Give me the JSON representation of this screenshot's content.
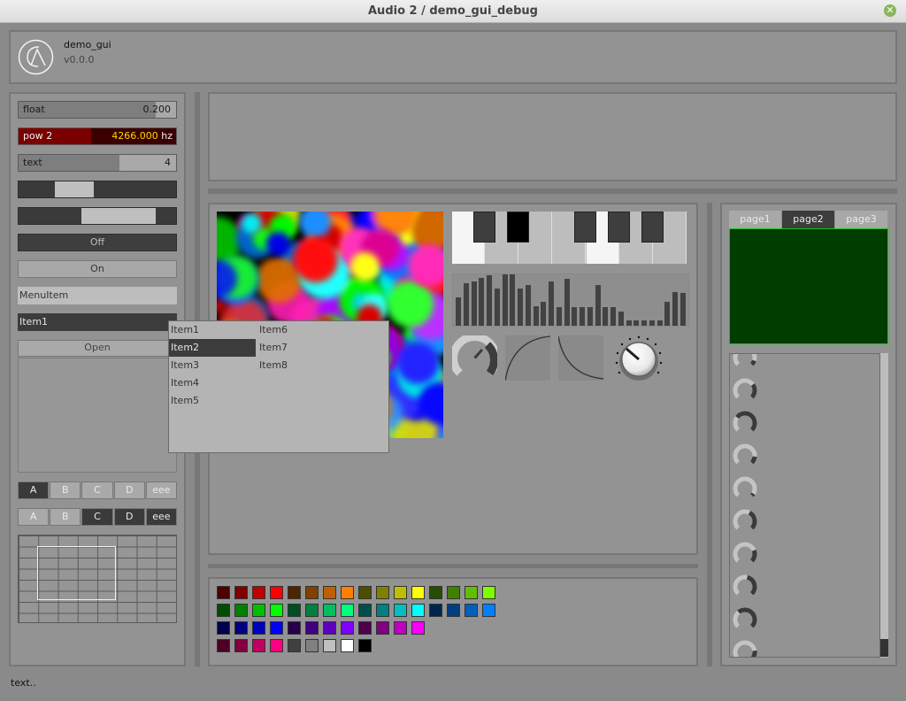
{
  "window": {
    "title": "Audio 2 / demo_gui_debug"
  },
  "header": {
    "app_name": "demo_gui",
    "version": "v0.0.0"
  },
  "controls": {
    "float": {
      "label": "float",
      "value": "0.200",
      "level": 0.87
    },
    "pow2": {
      "label": "pow 2",
      "value": "4266.000",
      "unit": "hz",
      "level": 0.46
    },
    "text": {
      "label": "text",
      "value": "4",
      "level": 0.64
    },
    "range1": {
      "low": 0.23,
      "high": 0.48
    },
    "range2": {
      "low": 0.4,
      "high": 0.87
    },
    "toggle_off": "Off",
    "toggle_on": "On",
    "menuitem": "MenuItem",
    "dropdown_selected": "Item1",
    "open_button": "Open",
    "segments_1": {
      "labels": [
        "A",
        "B",
        "C",
        "D",
        "eee"
      ],
      "active": [
        0
      ]
    },
    "segments_2": {
      "labels": [
        "A",
        "B",
        "C",
        "D",
        "eee"
      ],
      "active": [
        2,
        3,
        4
      ]
    }
  },
  "dropdown_menu": {
    "items": [
      "Item1",
      "Item2",
      "Item3",
      "Item4",
      "Item5",
      "Item6",
      "Item7",
      "Item8"
    ],
    "selected": "Item2"
  },
  "bar_levels": [
    0.55,
    0.83,
    0.87,
    0.93,
    0.98,
    0.72,
    1.0,
    1.0,
    0.72,
    0.8,
    0.38,
    0.47,
    0.87,
    0.37,
    0.92,
    0.37,
    0.37,
    0.37,
    0.8,
    0.37,
    0.37,
    0.28,
    0.11,
    0.11,
    0.11,
    0.11,
    0.11,
    0.47,
    0.65,
    0.63
  ],
  "keyboard": {
    "pressed_white_keys": [
      0,
      4
    ],
    "pressed_black_keys": [
      1
    ]
  },
  "tabs": {
    "items": [
      "page1",
      "page2",
      "page3"
    ],
    "active": "page2"
  },
  "colors": {
    "swatches": [
      [
        "#4d0000",
        "#800000",
        "#bf0000",
        "#ff0000",
        "#4d2600",
        "#804000",
        "#bf6000",
        "#ff8000",
        "#4d4d00",
        "#808000",
        "#bfbf00",
        "#ffff00",
        "#264d00",
        "#408000",
        "#60bf00",
        "#80ff00"
      ],
      [
        "#004d00",
        "#008000",
        "#00bf00",
        "#00ff00",
        "#004d26",
        "#008040",
        "#00bf60",
        "#00ff80",
        "#004d4d",
        "#008080",
        "#00bfbf",
        "#00ffff",
        "#00264d",
        "#004080",
        "#0060bf",
        "#0080ff"
      ],
      [
        "#00004d",
        "#000080",
        "#0000bf",
        "#0000ff",
        "#26004d",
        "#400080",
        "#6000bf",
        "#8000ff",
        "#4d004d",
        "#800080",
        "#bf00bf",
        "#ff00ff"
      ],
      [
        "#4d0026",
        "#800040",
        "#bf0060",
        "#ff0080",
        "#404040",
        "#808080",
        "#c0c0c0",
        "#ffffff",
        "#000000"
      ]
    ],
    "selection_green": "#1bc01b",
    "pow_value": "#ffd400"
  },
  "status": {
    "text": "text.."
  }
}
